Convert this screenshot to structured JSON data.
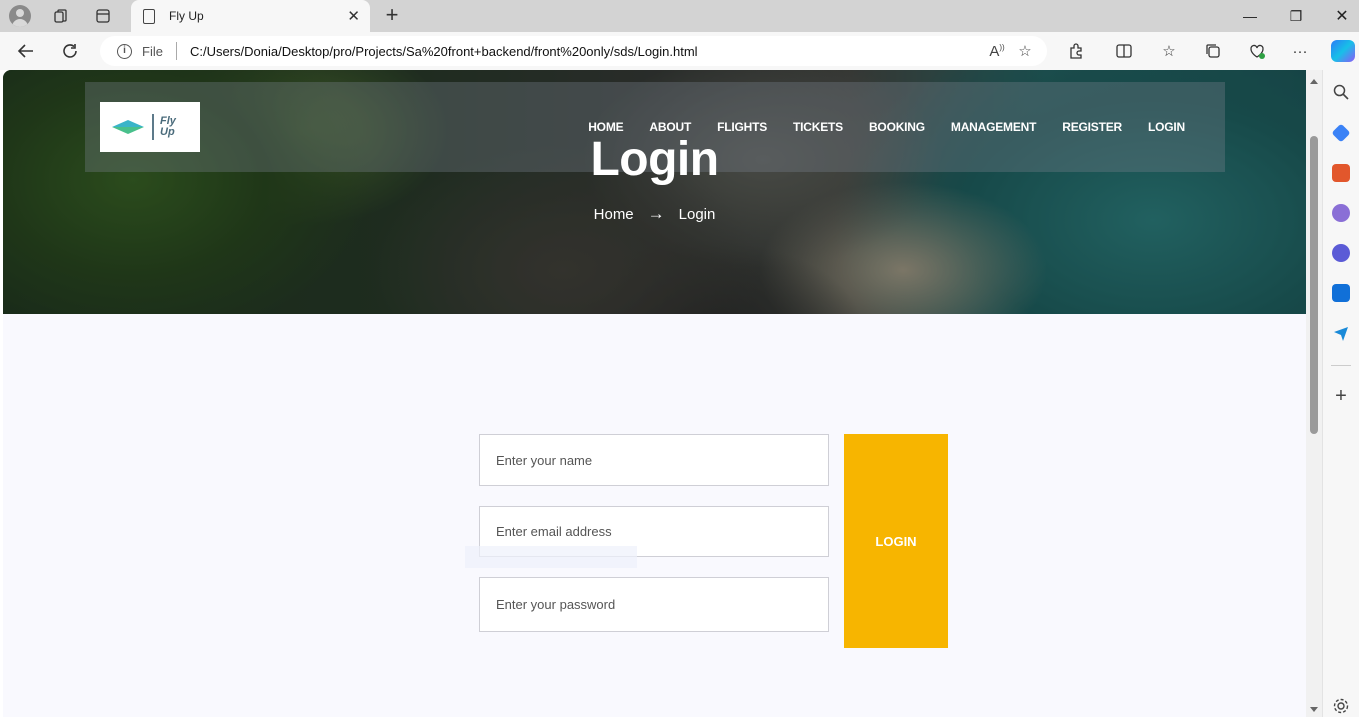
{
  "browser": {
    "tab_title": "Fly Up",
    "scheme_label": "File",
    "url": "C:/Users/Donia/Desktop/pro/Projects/Sa%20front+backend/front%20only/sds/Login.html"
  },
  "site": {
    "logo_text": "Fly Up",
    "nav": [
      "HOME",
      "ABOUT",
      "FLIGHTS",
      "TICKETS",
      "BOOKING",
      "MANAGEMENT",
      "REGISTER",
      "LOGIN"
    ],
    "hero_title": "Login",
    "breadcrumb": {
      "home": "Home",
      "current": "Login"
    }
  },
  "form": {
    "name_placeholder": "Enter your name",
    "email_placeholder": "Enter email address",
    "password_placeholder": "Enter your password",
    "submit_label": "LOGIN"
  },
  "colors": {
    "accent": "#f7b500",
    "page_bg": "#f9f9fe"
  }
}
